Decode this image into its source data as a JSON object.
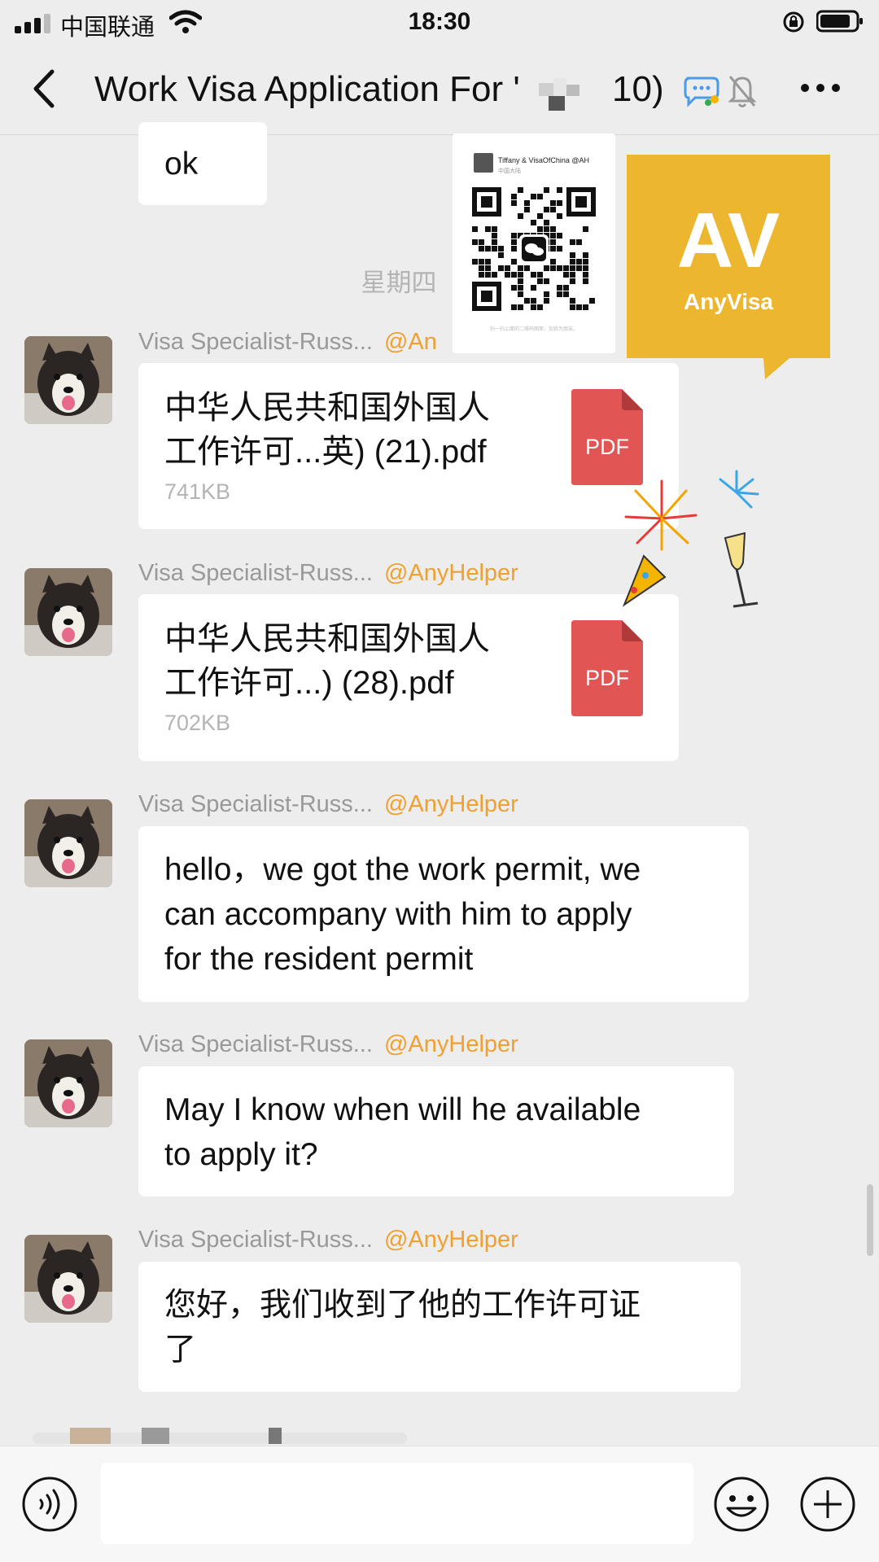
{
  "status_bar": {
    "carrier": "中国联通",
    "time": "18:30"
  },
  "header": {
    "title": "Work Visa Application For '",
    "title_end": "10)"
  },
  "messages_top": {
    "ok_text": "ok",
    "date_separator": "星期四"
  },
  "sticker": {
    "qr_header": "Tiffany & VisaOfChina @AH",
    "qr_sub": "中国大陆",
    "qr_footer": "扫一扫上面的二维码图案，加我为朋友。",
    "brand_mark": "AV",
    "brand_name": "AnyVisa"
  },
  "sender": {
    "name": "Visa Specialist-Russ...",
    "tag": "@AnyHelper",
    "tag_partial": "@An"
  },
  "files": [
    {
      "line1": "中华人民共和国外国人",
      "line2": "工作许可...英) (21).pdf",
      "size": "741KB",
      "icon_label": "PDF"
    },
    {
      "line1": "中华人民共和国外国人",
      "line2": "工作许可...) (28).pdf",
      "size": "702KB",
      "icon_label": "PDF"
    }
  ],
  "messages": [
    {
      "lines": [
        "hello，we got the work permit, we",
        "can accompany with him to apply",
        "for the resident permit"
      ]
    },
    {
      "lines": [
        "May I know when will he available",
        "to apply it?"
      ]
    },
    {
      "lines": [
        "您好，我们收到了他的工作许可证",
        "了"
      ]
    }
  ],
  "icons": {
    "back": "chevron-left-icon",
    "chat": "chat-bubble-icon",
    "mute": "bell-off-icon",
    "more": "more-dots-icon",
    "voice": "voice-icon",
    "emoji": "emoji-icon",
    "plus": "plus-icon"
  },
  "colors": {
    "background": "#ededed",
    "bubble": "#ffffff",
    "tag": "#f0a030",
    "pdf": "#e15554",
    "anyvisa": "#ecb72e"
  }
}
